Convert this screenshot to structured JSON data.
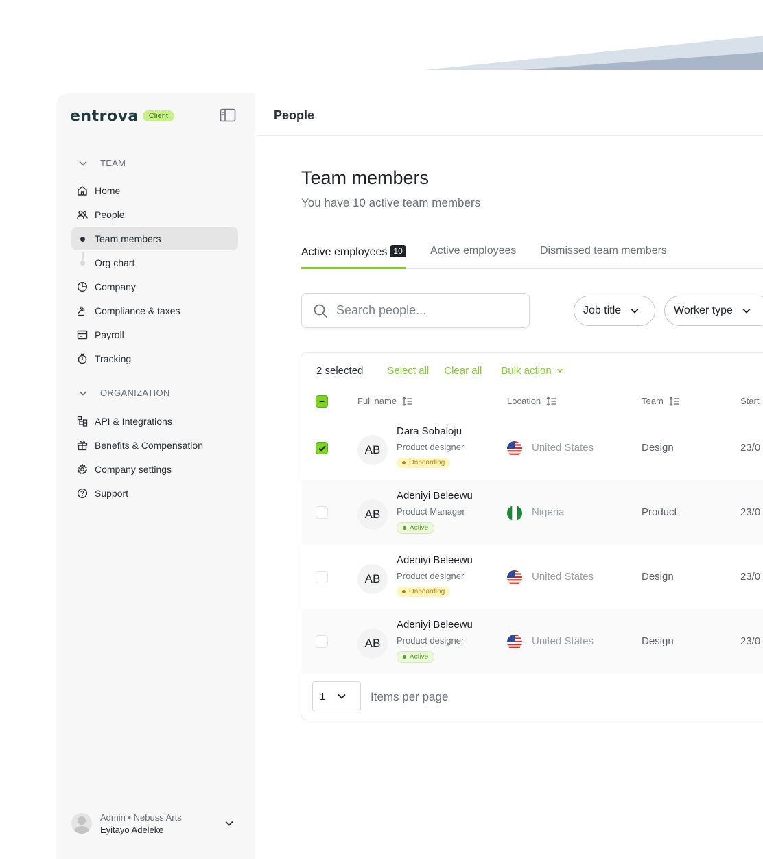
{
  "brand": {
    "logo": "entrova",
    "badge": "Client"
  },
  "sidebar": {
    "team_section": "TEAM",
    "org_section": "ORGANIZATION",
    "items": [
      {
        "label": "Home"
      },
      {
        "label": "People"
      },
      {
        "label": "Team members"
      },
      {
        "label": "Org chart"
      },
      {
        "label": "Company"
      },
      {
        "label": "Compliance & taxes"
      },
      {
        "label": "Payroll"
      },
      {
        "label": "Tracking"
      }
    ],
    "org_items": [
      {
        "label": "API & Integrations"
      },
      {
        "label": "Benefits & Compensation"
      },
      {
        "label": "Company settings"
      },
      {
        "label": "Support"
      }
    ],
    "user": {
      "role_line": "Admin • Nebuss Arts",
      "name": "Eyitayo Adeleke"
    }
  },
  "header": {
    "title": "People"
  },
  "page": {
    "title": "Team members",
    "subtitle": "You have 10 active team members"
  },
  "tabs": [
    {
      "label": "Active employees",
      "count": "10"
    },
    {
      "label": "Active employees"
    },
    {
      "label": "Dismissed team members"
    }
  ],
  "search": {
    "placeholder": "Search people..."
  },
  "filters": {
    "job_title": "Job title",
    "worker_type": "Worker type"
  },
  "bulk": {
    "selected": "2 selected",
    "select_all": "Select all",
    "clear_all": "Clear all",
    "bulk_action": "Bulk action"
  },
  "columns": {
    "full_name": "Full name",
    "location": "Location",
    "team": "Team",
    "start": "Start"
  },
  "rows": [
    {
      "initials": "AB",
      "name": "Dara Sobaloju",
      "role": "Product designer",
      "status": "Onboarding",
      "location": "United States",
      "team": "Design",
      "date": "23/0",
      "checked": true
    },
    {
      "initials": "AB",
      "name": "Adeniyi Beleewu",
      "role": "Product Manager",
      "status": "Active",
      "location": "Nigeria",
      "team": "Product",
      "date": "23/0",
      "checked": false
    },
    {
      "initials": "AB",
      "name": "Adeniyi Beleewu",
      "role": "Product designer",
      "status": "Onboarding",
      "location": "United States",
      "team": "Design",
      "date": "23/0",
      "checked": false
    },
    {
      "initials": "AB",
      "name": "Adeniyi Beleewu",
      "role": "Product designer",
      "status": "Active",
      "location": "United States",
      "team": "Design",
      "date": "23/0",
      "checked": false
    }
  ],
  "pagination": {
    "value": "1",
    "label": "Items per page"
  },
  "colors": {
    "accent": "#7ed321",
    "dark": "#1f2328",
    "muted": "#6b7079",
    "onboarding": "#fff6bf",
    "active": "#ecf8dd"
  },
  "icons": [
    "sidebar-toggle-icon",
    "chevron-down-icon",
    "home-icon",
    "people-icon",
    "company-icon",
    "gavel-icon",
    "payroll-icon",
    "stopwatch-icon",
    "api-icon",
    "gift-icon",
    "gear-icon",
    "help-icon",
    "search-icon",
    "sort-icon",
    "us-flag-icon",
    "nigeria-flag-icon"
  ]
}
